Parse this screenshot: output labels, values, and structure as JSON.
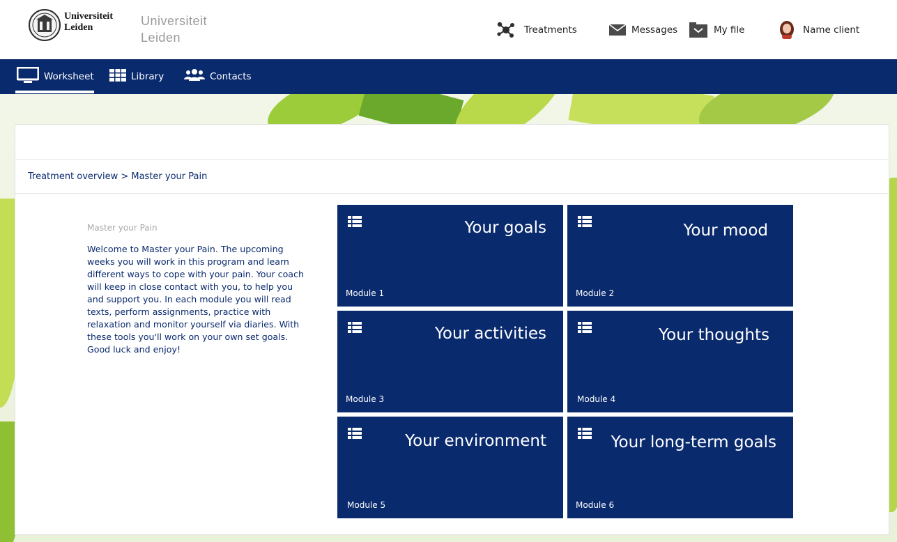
{
  "header": {
    "logo_line1": "Universiteit",
    "logo_line2": "Leiden",
    "brand_line1": "Universiteit",
    "brand_line2": "Leiden",
    "nav": {
      "treatments": "Treatments",
      "messages": "Messages",
      "my_file": "My file",
      "user": "Name client"
    }
  },
  "mainnav": {
    "worksheet": "Worksheet",
    "library": "Library",
    "contacts": "Contacts",
    "active": "Worksheet"
  },
  "breadcrumb": "Treatment overview > Master your Pain",
  "intro": {
    "title": "Master your Pain",
    "text": "Welcome to Master your Pain. The upcoming weeks you will work in this program and learn different ways to cope with your pain. Your coach will keep in close contact with you, to help you and support you. In each module you will read texts, perform assignments, practice with relaxation and monitor yourself via diaries. With these tools you'll work on your own set goals. Good luck and enjoy!"
  },
  "modules": [
    {
      "title": "Your goals",
      "label": "Module 1"
    },
    {
      "title": "Your mood",
      "label": "Module 2"
    },
    {
      "title": "Your activities",
      "label": "Module 3"
    },
    {
      "title": "Your thoughts",
      "label": "Module 4"
    },
    {
      "title": "Your environment",
      "label": "Module 5"
    },
    {
      "title": "Your long-term goals",
      "label": "Module 6"
    }
  ],
  "colors": {
    "primary": "#0a2a6e",
    "muted_text": "#a8a8a8",
    "header_bg": "#ffffff"
  },
  "icons": {
    "treatments": "molecule-icon",
    "messages": "envelope-icon",
    "my_file": "folder-icon",
    "user": "avatar",
    "worksheet": "monitor-icon",
    "library": "grid-icon",
    "contacts": "people-icon",
    "module": "list-icon"
  }
}
